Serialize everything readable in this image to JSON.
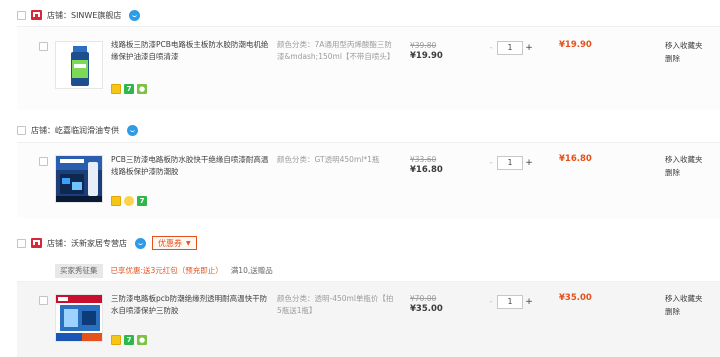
{
  "shops": [
    {
      "label": "店铺：SINWE旗舰店",
      "items": [
        {
          "title": "线路板三防漆PCB电路板主板防水胶防潮电机绝缘保护油漆自喷清漆",
          "attr": "颜色分类：7A通用型丙烯酸酯三防漆&mdash;150ml【不带自喷头】",
          "old_price": "¥39.80",
          "new_price": "¥19.90",
          "qty": "1",
          "sum": "¥19.90",
          "op1": "移入收藏夹",
          "op2": "删除"
        }
      ]
    },
    {
      "label": "店铺：屹嘉临润滑油专供",
      "items": [
        {
          "title": "PCB三防漆电路板防水胶快干绝缘自喷漆耐高温线路板保护漆防潮胶",
          "attr": "颜色分类：GT透明450ml*1瓶",
          "old_price": "¥33.60",
          "new_price": "¥16.80",
          "qty": "1",
          "sum": "¥16.80",
          "op1": "移入收藏夹",
          "op2": "删除"
        }
      ]
    },
    {
      "label": "店铺：沃新家居专营店",
      "coupon": "优惠券",
      "promo": {
        "button": "买家秀征集",
        "red": "已享优惠:送3元红包（预充即止）",
        "grey": "满10,送赠品"
      },
      "items": [
        {
          "title": "三防漆电路板pcb防潮绝缘剂透明耐高温快干防水自喷漆保护三防胶",
          "attr": "颜色分类：透明-450ml单瓶价【拍5瓶送1瓶】",
          "old_price": "¥70.00",
          "new_price": "¥35.00",
          "qty": "1",
          "sum": "¥35.00",
          "op1": "移入收藏夹",
          "op2": "删除"
        }
      ]
    }
  ],
  "qty_minus": "-",
  "qty_plus": "+",
  "colors": {
    "accent": "#e5511d",
    "tmall": "#d9263a",
    "wangwang": "#2d9be6"
  }
}
